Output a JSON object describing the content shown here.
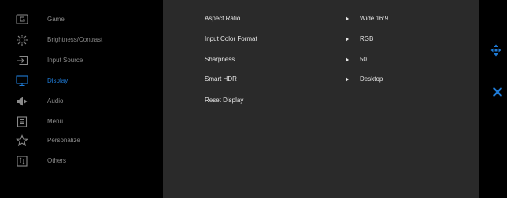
{
  "menu": {
    "items": [
      {
        "label": "Game",
        "icon": "game-icon",
        "active": false
      },
      {
        "label": "Brightness/Contrast",
        "icon": "brightness-icon",
        "active": false
      },
      {
        "label": "Input Source",
        "icon": "input-source-icon",
        "active": false
      },
      {
        "label": "Display",
        "icon": "display-icon",
        "active": true
      },
      {
        "label": "Audio",
        "icon": "speaker-icon",
        "active": false
      },
      {
        "label": "Menu",
        "icon": "menu-icon",
        "active": false
      },
      {
        "label": "Personalize",
        "icon": "star-icon",
        "active": false
      },
      {
        "label": "Others",
        "icon": "others-icon",
        "active": false
      }
    ]
  },
  "display_settings": [
    {
      "name": "Aspect Ratio",
      "value": "Wide 16:9",
      "has_arrow": true
    },
    {
      "name": "Input Color Format",
      "value": "RGB",
      "has_arrow": true
    },
    {
      "name": "Sharpness",
      "value": "50",
      "has_arrow": true
    },
    {
      "name": "Smart HDR",
      "value": "Desktop",
      "has_arrow": true
    },
    {
      "name": "Reset Display",
      "value": "",
      "has_arrow": false
    }
  ],
  "side_controls": {
    "navigate_icon": "navigate-icon",
    "close_icon": "close-icon"
  },
  "colors": {
    "accent": "#1f7bd6",
    "inactive": "#8a8a8a",
    "panel_bg": "#2a2a2a",
    "text": "#e6e6e6"
  }
}
